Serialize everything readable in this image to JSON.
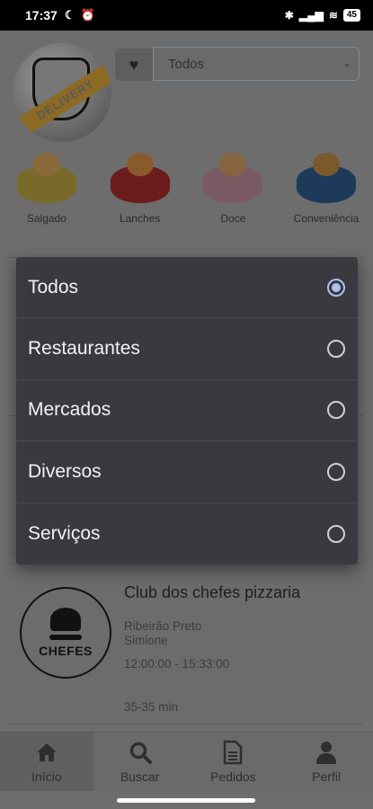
{
  "status_bar": {
    "time": "17:37",
    "battery": "45"
  },
  "header": {
    "logo_text": "DELIVERY",
    "favorite_icon": "heart-icon",
    "filter_value": "Todos"
  },
  "categories": [
    {
      "label": "Salgado"
    },
    {
      "label": "Lanches"
    },
    {
      "label": "Doce"
    },
    {
      "label": "Conveniência"
    }
  ],
  "restaurant": {
    "name": "Club dos chefes pizzaria",
    "logo_text": "CHEFES",
    "city": "Ribeirão Preto",
    "district": "Simione",
    "hours": "12:00:00 - 15:33:00",
    "delivery_time": "35-35 min"
  },
  "dialog": {
    "options": [
      {
        "label": "Todos",
        "selected": true
      },
      {
        "label": "Restaurantes",
        "selected": false
      },
      {
        "label": "Mercados",
        "selected": false
      },
      {
        "label": "Diversos",
        "selected": false
      },
      {
        "label": "Serviços",
        "selected": false
      }
    ],
    "accent_color": "#a7c4f2"
  },
  "bottom_nav": [
    {
      "label": "Início",
      "icon": "home-icon"
    },
    {
      "label": "Buscar",
      "icon": "search-icon"
    },
    {
      "label": "Pedidos",
      "icon": "document-icon"
    },
    {
      "label": "Perfil",
      "icon": "user-icon"
    }
  ]
}
